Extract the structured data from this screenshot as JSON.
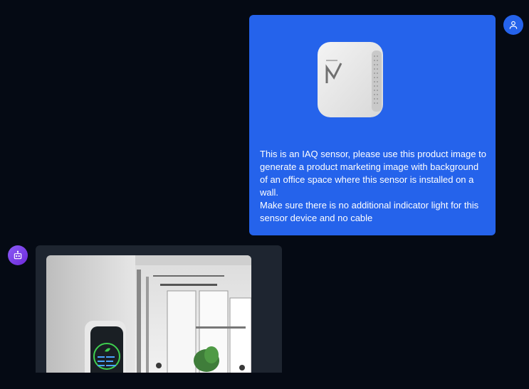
{
  "conversation": {
    "user_message": {
      "lines": [
        "This is an IAQ sensor, please use this product image to generate a product marketing image with background of an office space where this sensor is installed on a wall.",
        "Make sure there is no additional indicator light for this sensor device and no cable"
      ],
      "image_icon": "iaq-sensor-product-image"
    },
    "bot_message": {
      "image_icon": "generated-office-marketing-image"
    }
  },
  "icons": {
    "user_avatar": "user-icon",
    "bot_avatar": "robot-icon"
  },
  "colors": {
    "background": "#050a14",
    "user_bubble": "#2563eb",
    "bot_bubble": "#1e2530",
    "bot_avatar": "#7c3aed"
  }
}
